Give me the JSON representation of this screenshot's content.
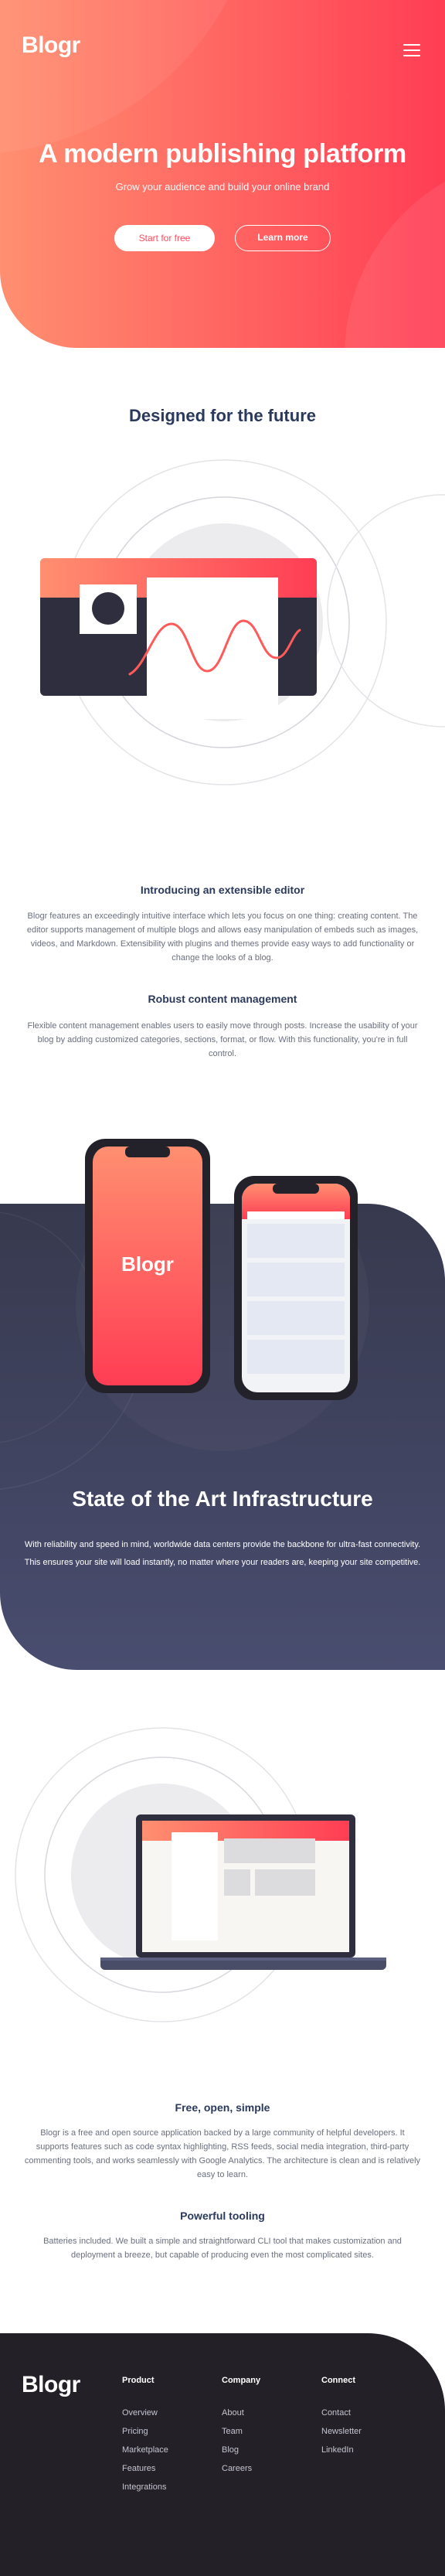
{
  "header": {
    "logo": "Blogr",
    "menu_icon": "hamburger-menu-icon"
  },
  "hero": {
    "title": "A modern publishing platform",
    "subtitle": "Grow your audience and build your online brand",
    "primary_button": "Start for free",
    "secondary_button": "Learn more"
  },
  "future": {
    "title": "Designed for the future",
    "items": [
      {
        "heading": "Introducing an extensible editor",
        "body": "Blogr features an exceedingly intuitive interface which lets you focus on one thing: creating content. The editor supports management of multiple blogs and allows easy manipulation of embeds such as images, videos, and Markdown. Extensibility with plugins and themes provide easy ways to add functionality or change the looks of a blog."
      },
      {
        "heading": "Robust content management",
        "body": "Flexible content management enables users to easily move through posts. Increase the usability of your blog by adding customized categories, sections, format, or flow. With this functionality, you're in full control."
      }
    ]
  },
  "infra": {
    "phone_logo": "Blogr",
    "title": "State of the Art Infrastructure",
    "body": "With reliability and speed in mind, worldwide data centers provide the backbone for ultra-fast connectivity. This ensures your site will load instantly, no matter where your readers are, keeping your site competitive."
  },
  "features": {
    "items": [
      {
        "heading": "Free, open, simple",
        "body": "Blogr is a free and open source application backed by a large community of helpful developers. It supports features such as code syntax highlighting, RSS feeds, social media integration, third-party commenting tools, and works seamlessly with Google Analytics. The architecture is clean and is relatively easy to learn."
      },
      {
        "heading": "Powerful tooling",
        "body": "Batteries included. We built a simple and straightforward CLI tool that makes customization and deployment a breeze, but capable of producing even the most complicated sites."
      }
    ]
  },
  "footer": {
    "logo": "Blogr",
    "columns": [
      {
        "title": "Product",
        "links": [
          "Overview",
          "Pricing",
          "Marketplace",
          "Features",
          "Integrations"
        ]
      },
      {
        "title": "Company",
        "links": [
          "About",
          "Team",
          "Blog",
          "Careers"
        ]
      },
      {
        "title": "Connect",
        "links": [
          "Contact",
          "Newsletter",
          "LinkedIn"
        ]
      }
    ]
  },
  "colors": {
    "hero_gradient_start": "#ff8f70",
    "hero_gradient_end": "#ff3d54",
    "heading_navy": "#2b3a5c",
    "body_gray": "#6b6f7f",
    "infra_dark": "#37394e",
    "footer_dark": "#232127"
  }
}
